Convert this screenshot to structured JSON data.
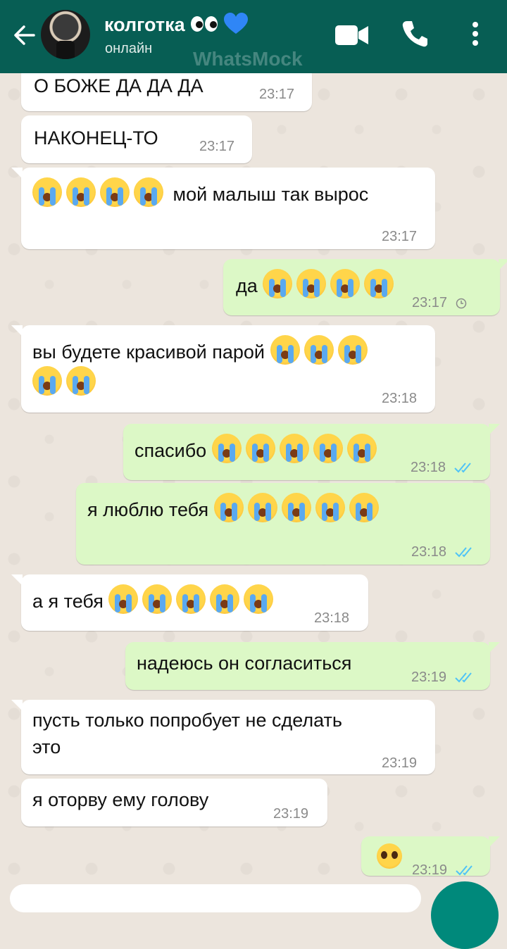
{
  "header": {
    "contact_name": "колготка",
    "contact_emoji": "👀💙",
    "status": "онлайн",
    "watermark": "WhatsMock",
    "icons": [
      "back-arrow-icon",
      "video-call-icon",
      "phone-icon",
      "more-options-icon"
    ]
  },
  "colors": {
    "header": "#075e54",
    "incoming": "#ffffff",
    "outgoing": "#dcf8c6",
    "read_tick": "#4fc3f7"
  },
  "messages": [
    {
      "dir": "in",
      "text": "О БОЖЕ ДА ДА ДА",
      "emoji_count": 0,
      "time": "23:17"
    },
    {
      "dir": "in",
      "text": "НАКОНЕЦ-ТО",
      "emoji_count": 0,
      "time": "23:17"
    },
    {
      "dir": "in",
      "text": "мой малыш так вырос",
      "emoji_count": 4,
      "emoji": "loudly-crying-face",
      "time": "23:17"
    },
    {
      "dir": "out",
      "text": "да",
      "emoji_count": 4,
      "emoji": "loudly-crying-face",
      "time": "23:17",
      "status": "pending"
    },
    {
      "dir": "in",
      "text": "вы будете красивой парой",
      "emoji_count": 5,
      "emoji": "loudly-crying-face",
      "time": "23:18"
    },
    {
      "dir": "out",
      "text": "спасибо",
      "emoji_count": 5,
      "emoji": "loudly-crying-face",
      "time": "23:18",
      "status": "read"
    },
    {
      "dir": "out",
      "text": "я люблю тебя",
      "emoji_count": 5,
      "emoji": "loudly-crying-face",
      "time": "23:18",
      "status": "read"
    },
    {
      "dir": "in",
      "text": "а я тебя",
      "emoji_count": 5,
      "emoji": "loudly-crying-face",
      "time": "23:18"
    },
    {
      "dir": "out",
      "text": "надеюсь он согласиться",
      "emoji_count": 0,
      "time": "23:19",
      "status": "read"
    },
    {
      "dir": "in",
      "text": "пусть только попробует не сделать\nэто",
      "emoji_count": 0,
      "time": "23:19"
    },
    {
      "dir": "in",
      "text": "я оторву ему голову",
      "emoji_count": 0,
      "time": "23:19"
    },
    {
      "dir": "out",
      "text": "",
      "emoji_count": 1,
      "emoji": "pleading-face",
      "time": "23:19",
      "status": "read"
    }
  ]
}
